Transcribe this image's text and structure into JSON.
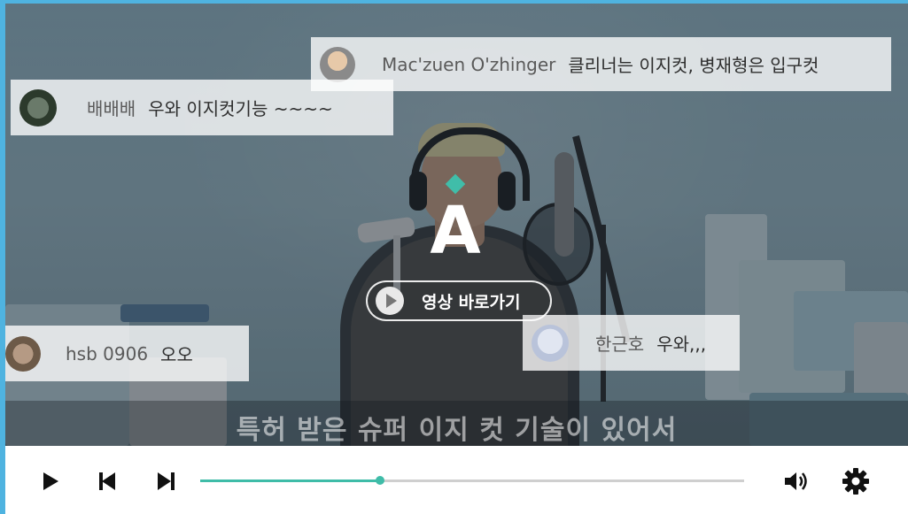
{
  "comments": [
    {
      "user": "Mac'zuen O'zhinger",
      "message": "클리너는 이지컷, 병재형은 입구컷"
    },
    {
      "user": "배배배",
      "message": "우와 이지컷기능 ~~~~"
    },
    {
      "user": "hsb 0906",
      "message": "오오"
    },
    {
      "user": "한근호",
      "message": "우와,,,"
    }
  ],
  "logo": {
    "letter": "A",
    "accent_color": "#40bda9"
  },
  "goto_button": {
    "label": "영상 바로가기"
  },
  "subtitle": "특허 받은 슈퍼 이지 컷 기술이 있어서",
  "controls": {
    "progress": 0.33,
    "accent_color": "#3fbca8",
    "icons": [
      "play-icon",
      "previous-icon",
      "next-icon",
      "volume-icon",
      "gear-icon"
    ]
  }
}
